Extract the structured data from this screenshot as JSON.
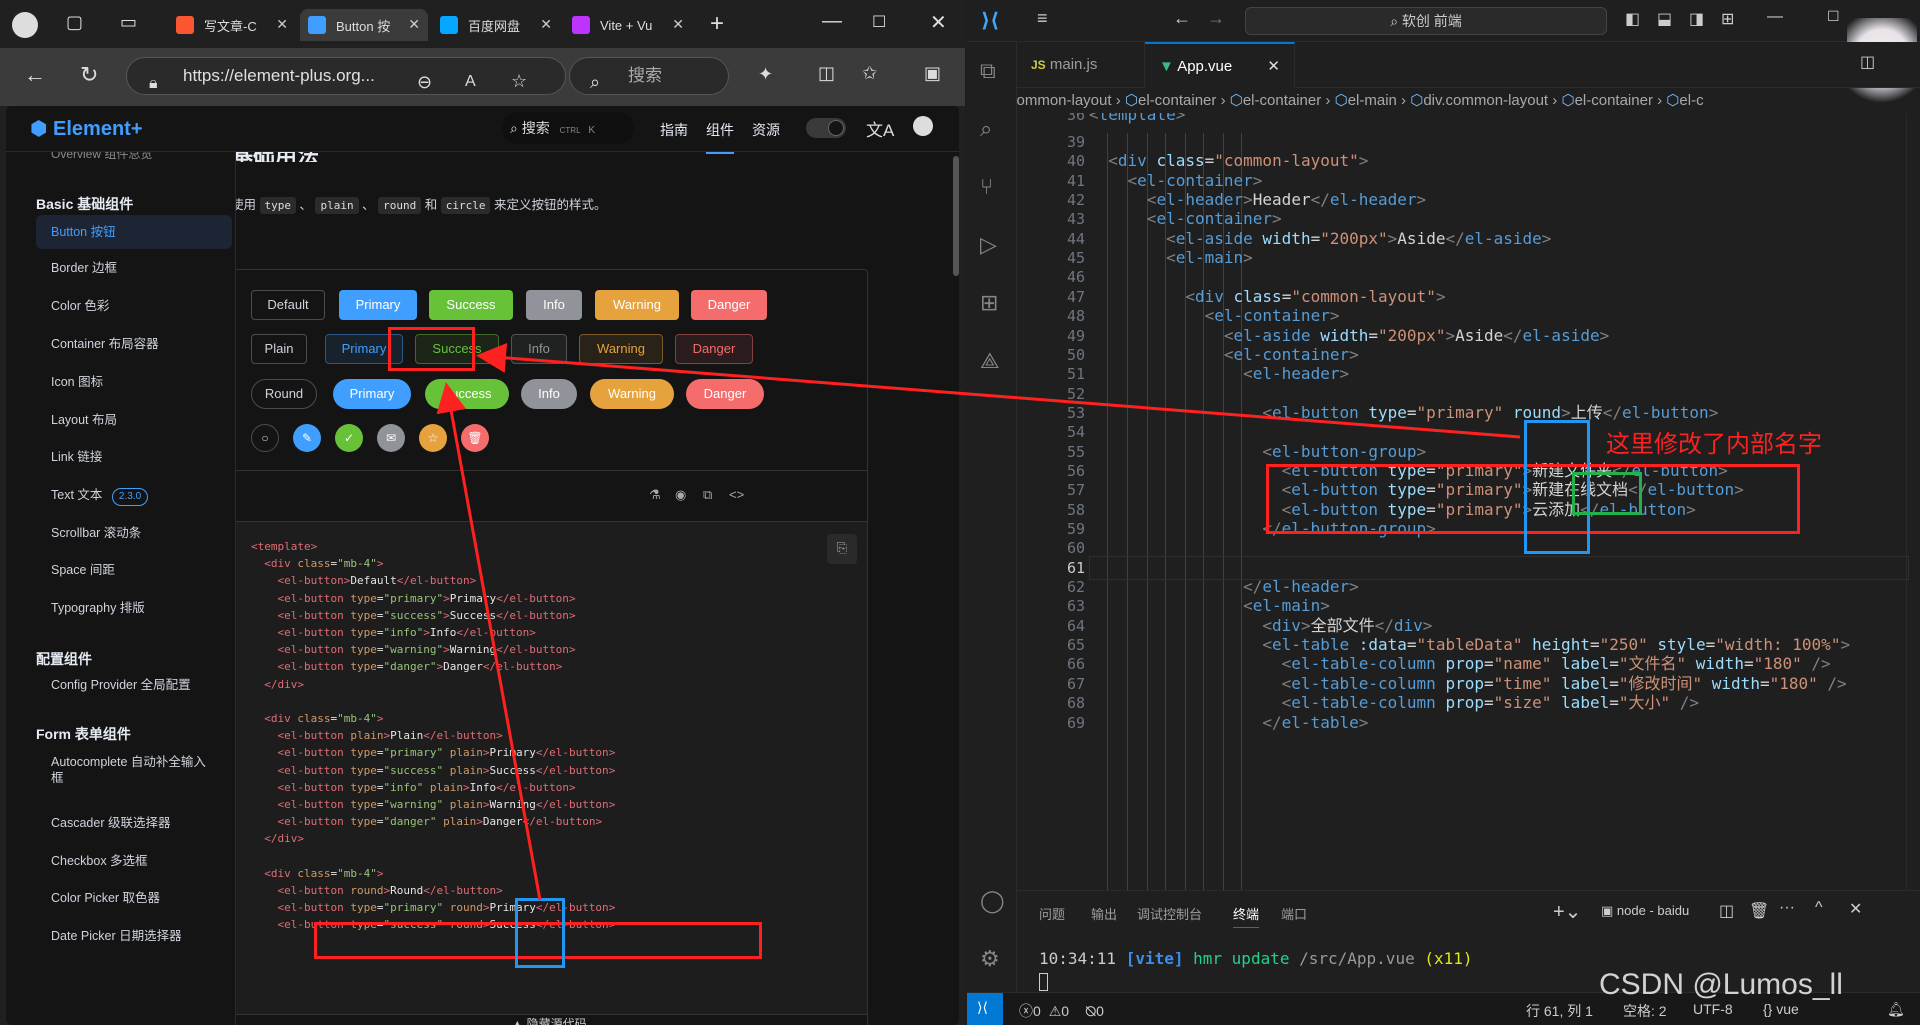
{
  "browser": {
    "tabs": [
      {
        "label": "写文章-C",
        "favicon_color": "#fc5531"
      },
      {
        "label": "Button 按",
        "favicon_color": "#409eff"
      },
      {
        "label": "百度网盘",
        "favicon_color": "#06a7ff"
      },
      {
        "label": "Vite + Vu",
        "favicon_color": "#bd34fe"
      }
    ],
    "url": "https://element-plus.org...",
    "search_placeholder": "搜索"
  },
  "site": {
    "logo": "Element+",
    "search_label": "搜索",
    "search_kbd": [
      "CTRL",
      "K"
    ],
    "nav": [
      "指南",
      "组件",
      "资源"
    ],
    "sidebar": {
      "partial_top": "Overview 组件总览",
      "groups": [
        {
          "title": "Basic 基础组件",
          "items": [
            "Button 按钮",
            "Border 边框",
            "Color 色彩",
            "Container 布局容器",
            "Icon 图标",
            "Layout 布局",
            "Link 链接",
            "Text 文本",
            "Scrollbar 滚动条",
            "Space 间距",
            "Typography 排版"
          ]
        },
        {
          "title": "配置组件",
          "items": [
            "Config Provider 全局配置"
          ]
        },
        {
          "title": "Form 表单组件",
          "items": [
            "Autocomplete 自动补全输入框",
            "Cascader 级联选择器",
            "Checkbox 多选框",
            "Color Picker 取色器",
            "Date Picker 日期选择器"
          ]
        }
      ],
      "text_badge": "2.3.0"
    },
    "content": {
      "heading_partial": "基础用法",
      "desc_prefix": "使用",
      "desc_codes": [
        "type",
        "plain",
        "round",
        "circle"
      ],
      "desc_sep": "、",
      "desc_and": "和",
      "desc_suffix": "来定义按钮的样式。",
      "button_labels": [
        "Default",
        "Primary",
        "Success",
        "Info",
        "Warning",
        "Danger"
      ],
      "plain_first": "Plain",
      "round_first": "Round",
      "hide_code": "隐藏源代码"
    },
    "code_lines": [
      "<template>",
      "  <div class=\"mb-4\">",
      "    <el-button>Default</el-button>",
      "    <el-button type=\"primary\">Primary</el-button>",
      "    <el-button type=\"success\">Success</el-button>",
      "    <el-button type=\"info\">Info</el-button>",
      "    <el-button type=\"warning\">Warning</el-button>",
      "    <el-button type=\"danger\">Danger</el-button>",
      "  </div>",
      "",
      "  <div class=\"mb-4\">",
      "    <el-button plain>Plain</el-button>",
      "    <el-button type=\"primary\" plain>Primary</el-button>",
      "    <el-button type=\"success\" plain>Success</el-button>",
      "    <el-button type=\"info\" plain>Info</el-button>",
      "    <el-button type=\"warning\" plain>Warning</el-button>",
      "    <el-button type=\"danger\" plain>Danger</el-button>",
      "  </div>",
      "",
      "  <div class=\"mb-4\">",
      "    <el-button round>Round</el-button>",
      "    <el-button type=\"primary\" round>Primary</el-button>",
      "    <el-button type=\"success\" round>Success</el-button>"
    ]
  },
  "vscode": {
    "search": "软创 前端",
    "tabs": [
      "main.js",
      "App.vue"
    ],
    "breadcrumb": [
      "common-layout",
      "el-container",
      "el-container",
      "el-main",
      "div.common-layout",
      "el-container",
      "el-c"
    ],
    "lines": [
      {
        "n": 36,
        "text": "<template>"
      },
      {
        "n": 39,
        "text": ""
      },
      {
        "n": 40,
        "text": "  <div class=\"common-layout\">"
      },
      {
        "n": 41,
        "text": "    <el-container>"
      },
      {
        "n": 42,
        "text": "      <el-header>Header</el-header>"
      },
      {
        "n": 43,
        "text": "      <el-container>"
      },
      {
        "n": 44,
        "text": "        <el-aside width=\"200px\">Aside</el-aside>"
      },
      {
        "n": 45,
        "text": "        <el-main>"
      },
      {
        "n": 46,
        "text": ""
      },
      {
        "n": 47,
        "text": "          <div class=\"common-layout\">"
      },
      {
        "n": 48,
        "text": "            <el-container>"
      },
      {
        "n": 49,
        "text": "              <el-aside width=\"200px\">Aside</el-aside>"
      },
      {
        "n": 50,
        "text": "              <el-container>"
      },
      {
        "n": 51,
        "text": "                <el-header>"
      },
      {
        "n": 52,
        "text": ""
      },
      {
        "n": 53,
        "text": "                  <el-button type=\"primary\" round>上传</el-button>"
      },
      {
        "n": 54,
        "text": ""
      },
      {
        "n": 55,
        "text": "                  <el-button-group>"
      },
      {
        "n": 56,
        "text": "                    <el-button type=\"primary\">新建文件夹</el-button>"
      },
      {
        "n": 57,
        "text": "                    <el-button type=\"primary\">新建在线文档</el-button>"
      },
      {
        "n": 58,
        "text": "                    <el-button type=\"primary\">云添加</el-button>"
      },
      {
        "n": 59,
        "text": "                  </el-button-group>"
      },
      {
        "n": 60,
        "text": ""
      },
      {
        "n": 61,
        "text": ""
      },
      {
        "n": 62,
        "text": "                </el-header>"
      },
      {
        "n": 63,
        "text": "                <el-main>"
      },
      {
        "n": 64,
        "text": "                  <div>全部文件</div>"
      },
      {
        "n": 65,
        "text": "                  <el-table :data=\"tableData\" height=\"250\" style=\"width: 100%\">"
      },
      {
        "n": 66,
        "text": "                    <el-table-column prop=\"name\" label=\"文件名\" width=\"180\" />"
      },
      {
        "n": 67,
        "text": "                    <el-table-column prop=\"time\" label=\"修改时间\" width=\"180\" />"
      },
      {
        "n": 68,
        "text": "                    <el-table-column prop=\"size\" label=\"大小\" />"
      },
      {
        "n": 69,
        "text": "                  </el-table>"
      }
    ],
    "current_line": 61,
    "annotation": "这里修改了内部名字",
    "panel_tabs": [
      "问题",
      "输出",
      "调试控制台",
      "终端",
      "端口"
    ],
    "terminal_name": "node - baidu",
    "terminal_time": "10:34:11",
    "terminal_tag": "[vite]",
    "terminal_msg": "hmr update",
    "terminal_path": "/src/App.vue",
    "terminal_count": "(x11)",
    "status": {
      "errors": "0",
      "warnings": "0",
      "ports": "0",
      "position": "行 61, 列 1",
      "spaces": "空格: 2",
      "encoding": "UTF-8",
      "lang": "vue"
    },
    "watermark": "CSDN @Lumos_ll"
  },
  "colors": {
    "primary": "#409eff",
    "success": "#67c23a",
    "info": "#909399",
    "warning": "#e6a23c",
    "danger": "#f56c6c",
    "highlight_red": "#ff2020",
    "highlight_blue": "#2196f3",
    "highlight_green": "#22b14c"
  }
}
